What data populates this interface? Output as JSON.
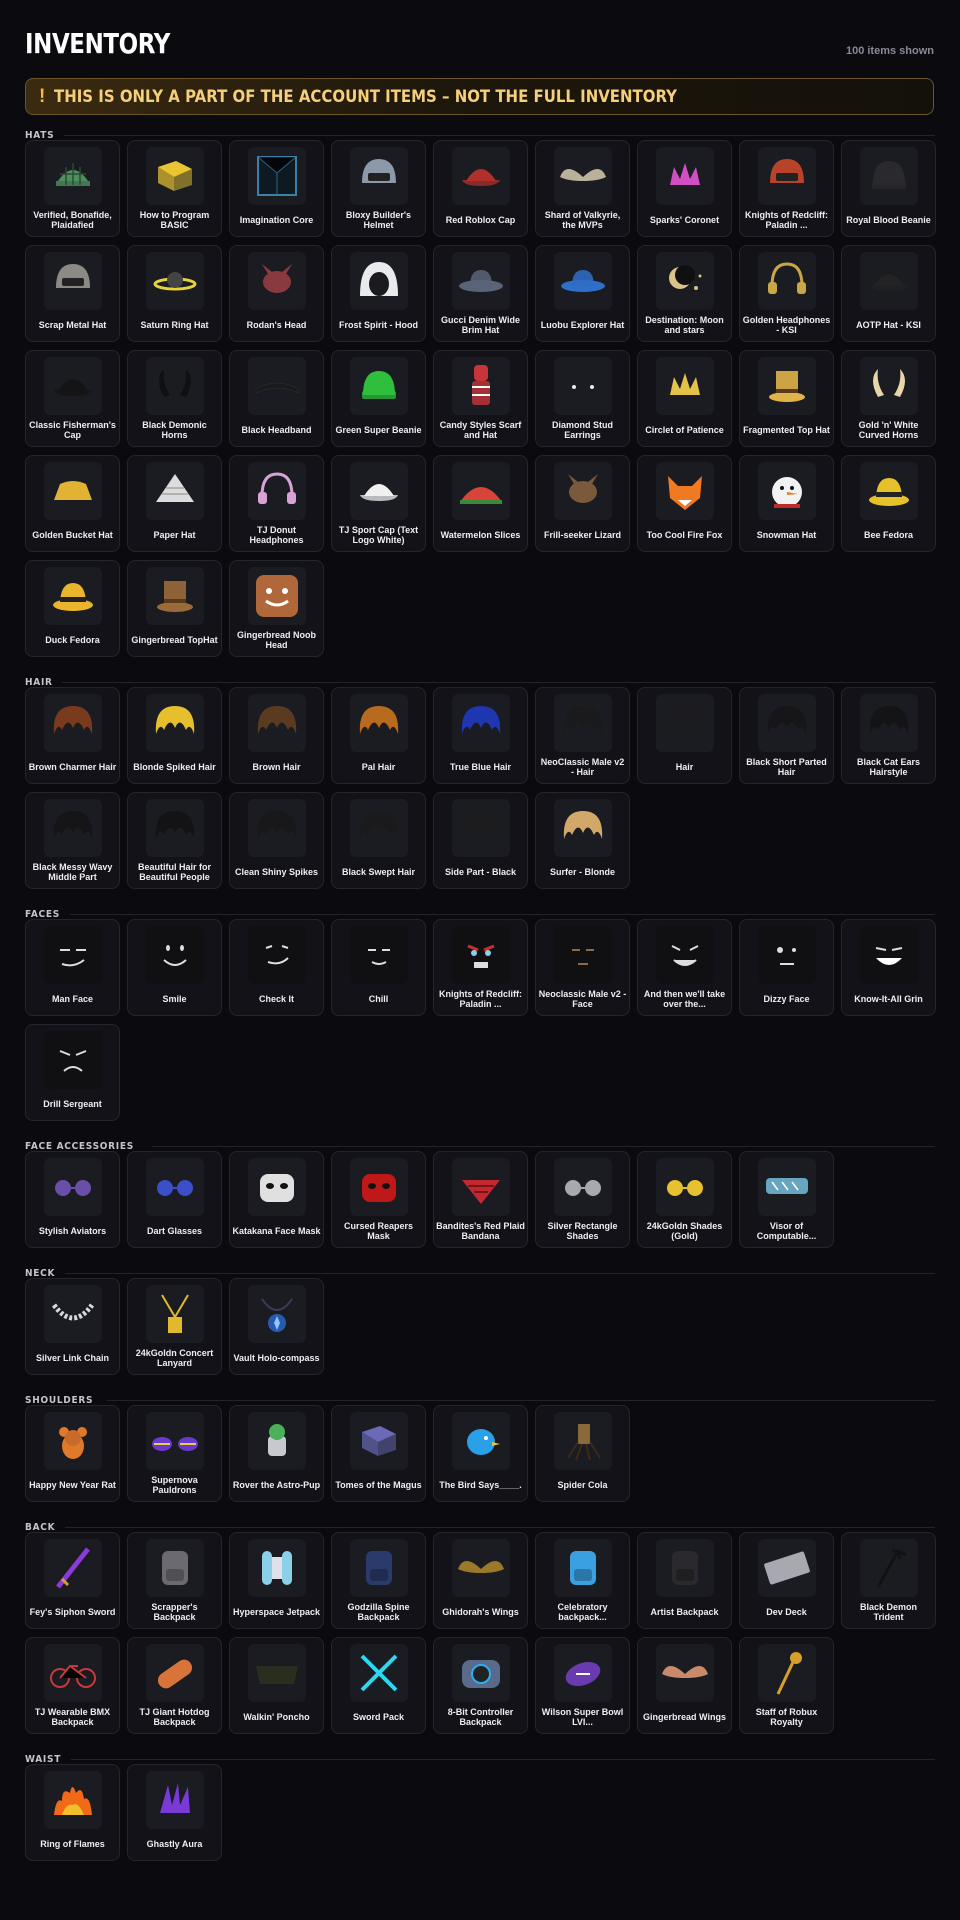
{
  "header": {
    "title": "INVENTORY",
    "count": "100 items shown",
    "banner_icon": "!",
    "banner": "THIS IS ONLY A PART OF THE ACCOUNT ITEMS – NOT THE FULL INVENTORY"
  },
  "colors": {
    "background": "#0a0a0f",
    "card": "#121218",
    "banner_text": "#f6cf7a",
    "banner_border": "#6a5526"
  },
  "sections": [
    {
      "title": "HATS",
      "items": [
        {
          "label": "Verified, Bonafide, Plaidafied",
          "icon": "plaid-cap",
          "color": "#4e8f5e"
        },
        {
          "label": "How to Program BASIC",
          "icon": "book",
          "color": "#e8c531"
        },
        {
          "label": "Imagination Core",
          "icon": "cube",
          "color": "#3c7fa8"
        },
        {
          "label": "Bloxy Builder's Helmet",
          "icon": "helmet",
          "color": "#8c99a8"
        },
        {
          "label": "Red Roblox Cap",
          "icon": "cap",
          "color": "#b0302c"
        },
        {
          "label": "Shard of Valkyrie, the MVPs",
          "icon": "wings",
          "color": "#b9b19a"
        },
        {
          "label": "Sparks' Coronet",
          "icon": "coronet",
          "color": "#d14fc3"
        },
        {
          "label": "Knights of Redcliff: Paladin ...",
          "icon": "helmet",
          "color": "#b8432a"
        },
        {
          "label": "Royal Blood Beanie",
          "icon": "beanie",
          "color": "#2a2a2e"
        },
        {
          "label": "Scrap Metal Hat",
          "icon": "helmet",
          "color": "#8d8a85"
        },
        {
          "label": "Saturn Ring Hat",
          "icon": "ring",
          "color": "#e6d23a"
        },
        {
          "label": "Rodan's Head",
          "icon": "creature",
          "color": "#8a3a3e"
        },
        {
          "label": "Frost Spirit - Hood",
          "icon": "hood",
          "color": "#e8eaec"
        },
        {
          "label": "Gucci Denim Wide Brim Hat",
          "icon": "wide-hat",
          "color": "#5a6478"
        },
        {
          "label": "Luobu Explorer Hat",
          "icon": "wide-hat",
          "color": "#2f6fc8"
        },
        {
          "label": "Destination: Moon and stars",
          "icon": "moon",
          "color": "#d9c38a"
        },
        {
          "label": "Golden Headphones - KSI",
          "icon": "headphones",
          "color": "#c9a646"
        },
        {
          "label": "AOTP Hat - KSI",
          "icon": "cap",
          "color": "#232326"
        },
        {
          "label": "Classic Fisherman's Cap",
          "icon": "cap",
          "color": "#141416"
        },
        {
          "label": "Black Demonic Horns",
          "icon": "horns",
          "color": "#101012"
        },
        {
          "label": "Black Headband",
          "icon": "headband",
          "color": "#1a1a1c"
        },
        {
          "label": "Green Super Beanie",
          "icon": "beanie",
          "color": "#2fbf3c"
        },
        {
          "label": "Candy Styles Scarf and Hat",
          "icon": "scarf",
          "color": "#c8343a"
        },
        {
          "label": "Diamond Stud Earrings",
          "icon": "studs",
          "color": "#e8e8ee"
        },
        {
          "label": "Circlet of Patience",
          "icon": "coronet",
          "color": "#e5c34a"
        },
        {
          "label": "Fragmented Top Hat",
          "icon": "top-hat",
          "color": "#e0b44a"
        },
        {
          "label": "Gold 'n' White Curved Horns",
          "icon": "horns",
          "color": "#e6d6a8"
        },
        {
          "label": "Golden Bucket Hat",
          "icon": "bucket-hat",
          "color": "#e2b234"
        },
        {
          "label": "Paper Hat",
          "icon": "paper-hat",
          "color": "#dcdcdc"
        },
        {
          "label": "TJ Donut Headphones",
          "icon": "headphones",
          "color": "#d8a2d6"
        },
        {
          "label": "TJ Sport Cap (Text Logo White)",
          "icon": "cap",
          "color": "#f0f0f0"
        },
        {
          "label": "Watermelon Slices",
          "icon": "watermelon",
          "color": "#d8433a"
        },
        {
          "label": "Frill-seeker Lizard",
          "icon": "creature",
          "color": "#7a5a3a"
        },
        {
          "label": "Too Cool Fire Fox",
          "icon": "fox",
          "color": "#ef7a22"
        },
        {
          "label": "Snowman Hat",
          "icon": "snowman",
          "color": "#f2f2f2"
        },
        {
          "label": "Bee Fedora",
          "icon": "fedora",
          "color": "#e6c12a"
        },
        {
          "label": "Duck Fedora",
          "icon": "fedora",
          "color": "#e8b52c"
        },
        {
          "label": "Gingerbread TopHat",
          "icon": "top-hat",
          "color": "#9a6a3a"
        },
        {
          "label": "Gingerbread Noob Head",
          "icon": "ginger-head",
          "color": "#b0683a"
        }
      ]
    },
    {
      "title": "HAIR",
      "items": [
        {
          "label": "Brown Charmer Hair",
          "icon": "hair",
          "color": "#7a3a1e"
        },
        {
          "label": "Blonde Spiked Hair",
          "icon": "hair",
          "color": "#e6bf2e"
        },
        {
          "label": "Brown Hair",
          "icon": "hair",
          "color": "#5a3b20"
        },
        {
          "label": "Pal Hair",
          "icon": "hair",
          "color": "#b86a1e"
        },
        {
          "label": "True Blue Hair",
          "icon": "hair",
          "color": "#1e36b0"
        },
        {
          "label": "NeoClassic Male v2 - Hair",
          "icon": "hair",
          "color": "#1a1a1c"
        },
        {
          "label": "Hair",
          "icon": "hair",
          "color": "#1c1c20"
        },
        {
          "label": "Black Short Parted Hair",
          "icon": "hair",
          "color": "#161618"
        },
        {
          "label": "Black Cat Ears Hairstyle",
          "icon": "hair",
          "color": "#141416"
        },
        {
          "label": "Black Messy Wavy Middle Part",
          "icon": "hair",
          "color": "#151517"
        },
        {
          "label": "Beautiful Hair for Beautiful People",
          "icon": "hair",
          "color": "#131315"
        },
        {
          "label": "Clean Shiny Spikes",
          "icon": "hair",
          "color": "#18181a"
        },
        {
          "label": "Black Swept Hair",
          "icon": "hair",
          "color": "#1a1a1c"
        },
        {
          "label": "Side Part - Black",
          "icon": "hair",
          "color": "#1c1c1e"
        },
        {
          "label": "Surfer - Blonde",
          "icon": "hair",
          "color": "#d2a86a"
        }
      ]
    },
    {
      "title": "FACES",
      "items": [
        {
          "label": "Man Face",
          "icon": "face-man",
          "color": "#0a0a0a"
        },
        {
          "label": "Smile",
          "icon": "face-smile",
          "color": "#0a0a0a"
        },
        {
          "label": "Check It",
          "icon": "face-check",
          "color": "#0a0a0a"
        },
        {
          "label": "Chill",
          "icon": "face-chill",
          "color": "#0a0a0a"
        },
        {
          "label": "Knights of Redcliff: Paladin ...",
          "icon": "face-paladin",
          "color": "#c8302c"
        },
        {
          "label": "Neoclassic Male v2 - Face",
          "icon": "face-neo",
          "color": "#0a0a0a"
        },
        {
          "label": "And then we'll take over the...",
          "icon": "face-evil",
          "color": "#0a0a0a"
        },
        {
          "label": "Dizzy Face",
          "icon": "face-dizzy",
          "color": "#0a0a0a"
        },
        {
          "label": "Know-It-All Grin",
          "icon": "face-grin",
          "color": "#0a0a0a"
        },
        {
          "label": "Drill Sergeant",
          "icon": "face-sergeant",
          "color": "#0a0a0a"
        }
      ]
    },
    {
      "title": "FACE ACCESSORIES",
      "items": [
        {
          "label": "Stylish Aviators",
          "icon": "glasses",
          "color": "#6a4fa8"
        },
        {
          "label": "Dart Glasses",
          "icon": "glasses",
          "color": "#3a4fc8"
        },
        {
          "label": "Katakana Face Mask",
          "icon": "mask",
          "color": "#e0e0e0"
        },
        {
          "label": "Cursed Reapers Mask",
          "icon": "mask",
          "color": "#c01818"
        },
        {
          "label": "Bandites's Red Plaid Bandana",
          "icon": "bandana",
          "color": "#c2282e"
        },
        {
          "label": "Silver Rectangle Shades",
          "icon": "glasses",
          "color": "#a8a8b0"
        },
        {
          "label": "24kGoldn Shades (Gold)",
          "icon": "glasses",
          "color": "#e6c22e"
        },
        {
          "label": "Visor of Computable...",
          "icon": "visor",
          "color": "#7ac8e8"
        }
      ]
    },
    {
      "title": "NECK",
      "items": [
        {
          "label": "Silver Link Chain",
          "icon": "chain",
          "color": "#d8d8dc"
        },
        {
          "label": "24kGoldn Concert Lanyard",
          "icon": "lanyard",
          "color": "#e2b82e"
        },
        {
          "label": "Vault Holo-compass",
          "icon": "compass",
          "color": "#2a5ab0"
        }
      ]
    },
    {
      "title": "SHOULDERS",
      "items": [
        {
          "label": "Happy New Year Rat",
          "icon": "rat",
          "color": "#e07a2a"
        },
        {
          "label": "Supernova Pauldrons",
          "icon": "pauldrons",
          "color": "#6a3ad0"
        },
        {
          "label": "Rover the Astro-Pup",
          "icon": "pup",
          "color": "#4ab05a"
        },
        {
          "label": "Tomes of the Magus",
          "icon": "book",
          "color": "#6a6ab8"
        },
        {
          "label": "The Bird Says____.",
          "icon": "bird",
          "color": "#2aa0e8"
        },
        {
          "label": "Spider Cola",
          "icon": "spider",
          "color": "#3a2a18"
        }
      ]
    },
    {
      "title": "BACK",
      "items": [
        {
          "label": "Fey's Siphon Sword",
          "icon": "sword",
          "color": "#8a3ad8"
        },
        {
          "label": "Scrapper's Backpack",
          "icon": "backpack",
          "color": "#6a6a70"
        },
        {
          "label": "Hyperspace Jetpack",
          "icon": "jetpack",
          "color": "#8ad0e8"
        },
        {
          "label": "Godzilla Spine Backpack",
          "icon": "backpack",
          "color": "#2a3a6a"
        },
        {
          "label": "Ghidorah's Wings",
          "icon": "wings",
          "color": "#9a7a2a"
        },
        {
          "label": "Celebratory backpack...",
          "icon": "backpack",
          "color": "#3aa0e0"
        },
        {
          "label": "Artist Backpack",
          "icon": "backpack",
          "color": "#2a2a2e"
        },
        {
          "label": "Dev Deck",
          "icon": "keyboard",
          "color": "#a8a8b0"
        },
        {
          "label": "Black Demon Trident",
          "icon": "trident",
          "color": "#121214"
        },
        {
          "label": "TJ Wearable BMX Backpack",
          "icon": "bike",
          "color": "#c83a3a"
        },
        {
          "label": "TJ Giant Hotdog Backpack",
          "icon": "hotdog",
          "color": "#d8743a"
        },
        {
          "label": "Walkin' Poncho",
          "icon": "poncho",
          "color": "#2a2e1e"
        },
        {
          "label": "Sword Pack",
          "icon": "swords",
          "color": "#2ad8f0"
        },
        {
          "label": "8-Bit Controller Backpack",
          "icon": "controller",
          "color": "#5a6a8a"
        },
        {
          "label": "Wilson Super Bowl LVI...",
          "icon": "football",
          "color": "#6a3ab0"
        },
        {
          "label": "Gingerbread Wings",
          "icon": "wings",
          "color": "#c88a6a"
        },
        {
          "label": "Staff of Robux Royalty",
          "icon": "staff",
          "color": "#d8a02a"
        }
      ]
    },
    {
      "title": "WAIST",
      "items": [
        {
          "label": "Ring of Flames",
          "icon": "flames",
          "color": "#f06a1a"
        },
        {
          "label": "Ghastly Aura",
          "icon": "aura",
          "color": "#7a3ad8"
        }
      ]
    }
  ]
}
